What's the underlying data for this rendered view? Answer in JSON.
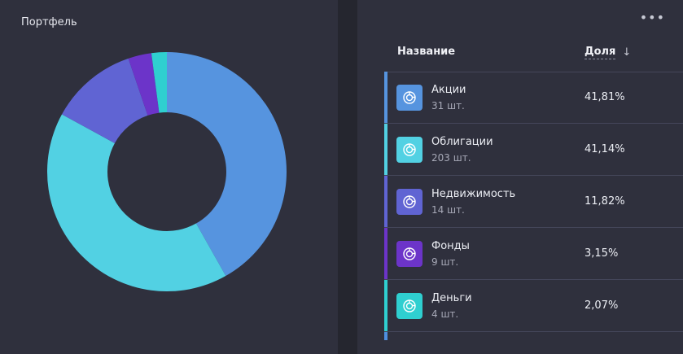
{
  "portfolio": {
    "title": "Портфель"
  },
  "table": {
    "col_name": "Название",
    "col_share": "Доля",
    "more_label": "•••",
    "sort_glyph": "↓",
    "rows": [
      {
        "name": "Акции",
        "count": "31 шт.",
        "share_text": "41,81%",
        "share": 41.81,
        "color": "#5694df",
        "icon": "pie-chart-icon"
      },
      {
        "name": "Облигации",
        "count": "203 шт.",
        "share_text": "41,14%",
        "share": 41.14,
        "color": "#52d1e3",
        "icon": "pie-chart-icon"
      },
      {
        "name": "Недвижимость",
        "count": "14 шт.",
        "share_text": "11,82%",
        "share": 11.82,
        "color": "#6064d3",
        "icon": "pie-chart-icon"
      },
      {
        "name": "Фонды",
        "count": "9 шт.",
        "share_text": "3,15%",
        "share": 3.15,
        "color": "#6c34c9",
        "icon": "pie-chart-icon"
      },
      {
        "name": "Деньги",
        "count": "4 шт.",
        "share_text": "2,07%",
        "share": 2.07,
        "color": "#2fcfd0",
        "icon": "pie-chart-icon"
      }
    ]
  }
}
